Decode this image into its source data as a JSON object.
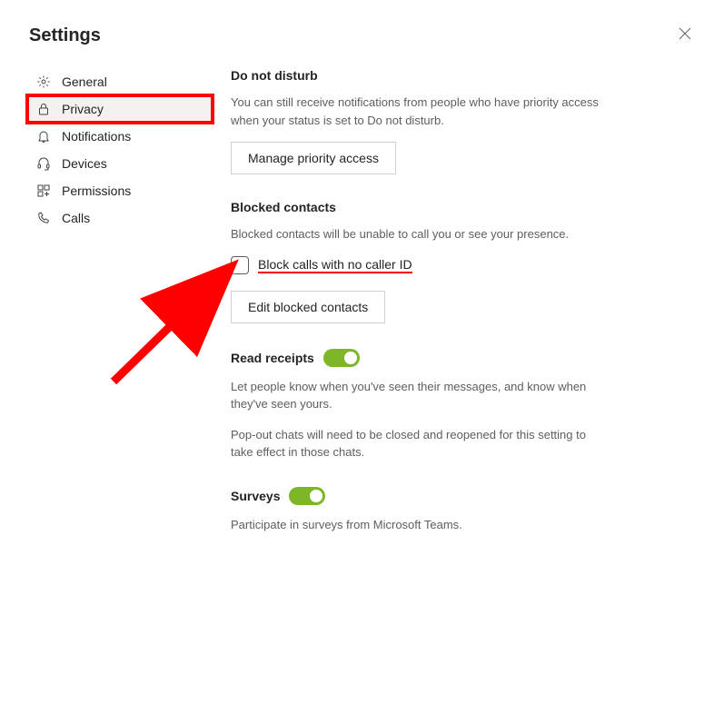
{
  "header": {
    "title": "Settings"
  },
  "sidebar": {
    "items": [
      {
        "label": "General"
      },
      {
        "label": "Privacy"
      },
      {
        "label": "Notifications"
      },
      {
        "label": "Devices"
      },
      {
        "label": "Permissions"
      },
      {
        "label": "Calls"
      }
    ]
  },
  "sections": {
    "dnd": {
      "title": "Do not disturb",
      "description": "You can still receive notifications from people who have priority access when your status is set to Do not disturb.",
      "button": "Manage priority access"
    },
    "blocked": {
      "title": "Blocked contacts",
      "description": "Blocked contacts will be unable to call you or see your presence.",
      "checkbox_label": "Block calls with no caller ID",
      "button": "Edit blocked contacts"
    },
    "read_receipts": {
      "title": "Read receipts",
      "description": "Let people know when you've seen their messages, and know when they've seen yours.",
      "description2": "Pop-out chats will need to be closed and reopened for this setting to take effect in those chats."
    },
    "surveys": {
      "title": "Surveys",
      "description": "Participate in surveys from Microsoft Teams."
    }
  }
}
